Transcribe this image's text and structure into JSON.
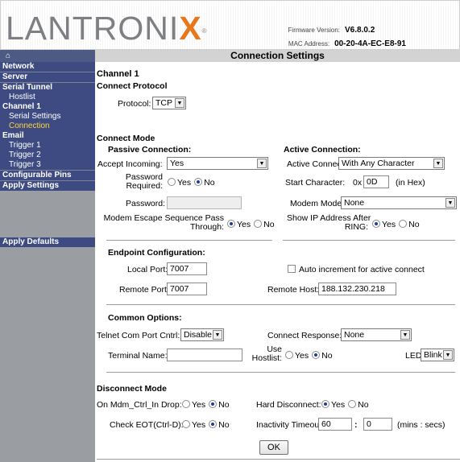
{
  "header": {
    "logo_main": "LANTRONI",
    "logo_x": "X",
    "logo_reg": "®",
    "firmware_label": "Firmware Version:",
    "firmware_value": "V6.8.0.2",
    "mac_label": "MAC Address:",
    "mac_value": "00-20-4A-EC-E8-91"
  },
  "sidebar": {
    "home": "⌂",
    "items": [
      {
        "label": "Network"
      },
      {
        "label": "Server"
      },
      {
        "label": "Serial Tunnel"
      },
      {
        "label": "Hostlist"
      },
      {
        "label": "Channel 1"
      },
      {
        "label": "Serial Settings"
      },
      {
        "label": "Connection"
      },
      {
        "label": "Email"
      },
      {
        "label": "Trigger 1"
      },
      {
        "label": "Trigger 2"
      },
      {
        "label": "Trigger 3"
      },
      {
        "label": "Configurable Pins"
      },
      {
        "label": "Apply Settings"
      },
      {
        "label": "Apply Defaults"
      }
    ]
  },
  "page": {
    "title": "Connection Settings",
    "channel": "Channel 1",
    "connect_protocol": {
      "heading": "Connect Protocol",
      "protocol_label": "Protocol:",
      "protocol_value": "TCP"
    },
    "connect_mode": {
      "heading": "Connect Mode",
      "passive": {
        "heading": "Passive Connection:",
        "accept_label": "Accept Incoming:",
        "accept_value": "Yes",
        "password_required_label_1": "Password",
        "password_required_label_2": "Required:",
        "password_label": "Password:",
        "modem_escape_label_1": "Modem Escape Sequence Pass",
        "modem_escape_label_2": "Through:"
      },
      "active": {
        "heading": "Active Connection:",
        "active_connect_label": "Active Connect:",
        "active_connect_value": "With Any Character",
        "start_char_label": "Start Character:",
        "start_char_prefix": "0x",
        "start_char_value": "0D",
        "start_char_suffix": "(in Hex)",
        "modem_mode_label": "Modem Mode:",
        "modem_mode_value": "None",
        "show_ip_label_1": "Show IP Address After",
        "show_ip_label_2": "RING:"
      }
    },
    "endpoint": {
      "heading": "Endpoint Configuration:",
      "local_port_label": "Local Port:",
      "local_port_value": "7007",
      "auto_increment_label": "Auto increment for active connect",
      "remote_port_label": "Remote Port:",
      "remote_port_value": "7007",
      "remote_host_label": "Remote Host:",
      "remote_host_value": "188.132.230.218"
    },
    "common": {
      "heading": "Common Options:",
      "telnet_label": "Telnet Com Port Cntrl:",
      "telnet_value": "Disable",
      "connect_response_label": "Connect Response:",
      "connect_response_value": "None",
      "terminal_name_label": "Terminal Name:",
      "terminal_name_value": "",
      "use_hostlist_label_1": "Use",
      "use_hostlist_label_2": "Hostlist:",
      "led_label": "LED:",
      "led_value": "Blink"
    },
    "disconnect": {
      "heading": "Disconnect Mode",
      "mdm_label": "On Mdm_Ctrl_In Drop:",
      "hard_label": "Hard Disconnect:",
      "eot_label": "Check EOT(Ctrl-D):",
      "inactivity_label": "Inactivity Timeout:",
      "inactivity_min": "60",
      "inactivity_sep": ":",
      "inactivity_sec": "0",
      "inactivity_units": "(mins : secs)"
    },
    "yes": "Yes",
    "no": "No",
    "ok_label": "OK"
  },
  "colors": {
    "sidebar_nav": "#3e4b82",
    "sidebar_bg": "#9a9da2",
    "active_item": "#ffd53a",
    "logo_x": "#e8761a"
  }
}
